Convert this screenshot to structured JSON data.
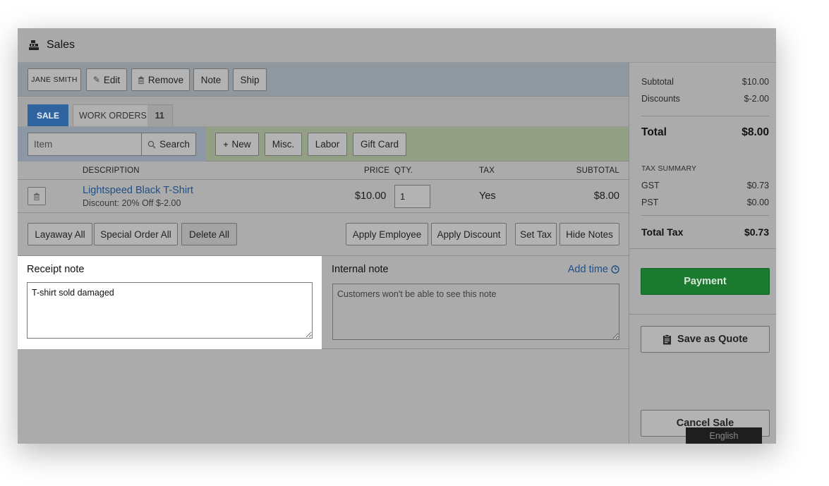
{
  "header": {
    "title": "Sales",
    "icon": "register-icon"
  },
  "customer_bar": {
    "customer": "JANE SMITH",
    "edit": "Edit",
    "remove": "Remove",
    "note": "Note",
    "ship": "Ship"
  },
  "tabs": {
    "sale": "SALE",
    "work_orders": "WORK ORDERS",
    "work_orders_count": "11"
  },
  "item_search": {
    "placeholder": "Item",
    "search": "Search"
  },
  "add_buttons": {
    "new": "New",
    "misc": "Misc.",
    "labor": "Labor",
    "gift_card": "Gift Card"
  },
  "table": {
    "headers": {
      "description": "DESCRIPTION",
      "price": "PRICE",
      "qty": "QTY.",
      "tax": "TAX",
      "subtotal": "SUBTOTAL"
    },
    "line": {
      "title": "Lightspeed Black T-Shirt",
      "discount": "Discount: 20% Off $-2.00",
      "price": "$10.00",
      "qty": "1",
      "tax": "Yes",
      "subtotal": "$8.00"
    }
  },
  "actions": {
    "layaway_all": "Layaway All",
    "special_order_all": "Special Order All",
    "delete_all": "Delete All",
    "apply_employee": "Apply Employee",
    "apply_discount": "Apply Discount",
    "set_tax": "Set Tax",
    "hide_notes": "Hide Notes"
  },
  "notes": {
    "receipt_label": "Receipt note",
    "receipt_value": "T-shirt sold damaged",
    "internal_label": "Internal note",
    "internal_placeholder": "Customers won't be able to see this note",
    "add_time": "Add time"
  },
  "summary": {
    "subtotal_label": "Subtotal",
    "subtotal": "$10.00",
    "discounts_label": "Discounts",
    "discounts": "$-2.00",
    "total_label": "Total",
    "total": "$8.00",
    "tax_summary_label": "TAX SUMMARY",
    "gst_label": "GST",
    "gst": "$0.73",
    "pst_label": "PST",
    "pst": "$0.00",
    "total_tax_label": "Total Tax",
    "total_tax": "$0.73"
  },
  "sidebar_buttons": {
    "payment": "Payment",
    "save_quote": "Save as Quote",
    "cancel_sale": "Cancel Sale"
  },
  "language": "English",
  "colors": {
    "sale_tab": "#2f64a0",
    "payment": "#1c7a30",
    "link": "#1f4f86"
  }
}
